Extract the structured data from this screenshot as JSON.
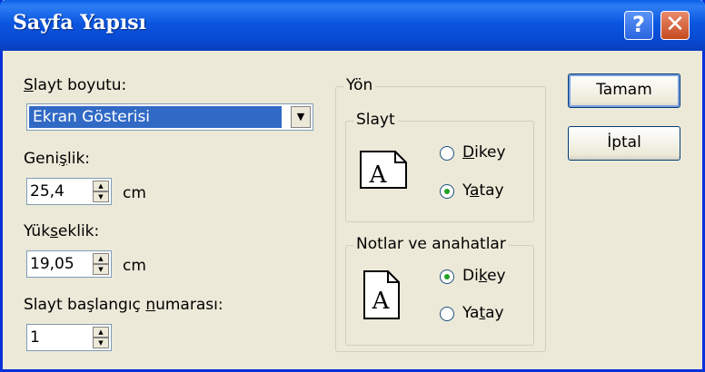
{
  "window": {
    "title": "Sayfa Yapısı",
    "help_label": "?",
    "close_label": "✕"
  },
  "slide_size": {
    "label_first": "S",
    "label_rest": "layt boyutu:",
    "value": "Ekran Gösterisi"
  },
  "width": {
    "label_pre": "Geni",
    "label_u": "ş",
    "label_post": "lik:",
    "value": "25,4",
    "unit": "cm"
  },
  "height": {
    "label_pre": "Yük",
    "label_u": "s",
    "label_post": "eklik:",
    "value": "19,05",
    "unit": "cm"
  },
  "start_number": {
    "label_pre": "Slayt başlangıç ",
    "label_u": "n",
    "label_post": "umarası:",
    "value": "1"
  },
  "orientation": {
    "title": "Yön",
    "slides": {
      "title": "Slayt",
      "portrait_u": "D",
      "portrait_rest": "ikey",
      "landscape_pre": "Y",
      "landscape_u": "a",
      "landscape_post": "tay",
      "selected": "Yatay"
    },
    "notes": {
      "title": "Notlar ve anahatlar",
      "portrait_pre": "Di",
      "portrait_u": "k",
      "portrait_post": "ey",
      "landscape_pre": "Ya",
      "landscape_u": "t",
      "landscape_post": "ay",
      "selected": "Dikey"
    }
  },
  "buttons": {
    "ok": "Tamam",
    "cancel": "İptal"
  },
  "icons": [
    "help-icon",
    "close-icon",
    "dropdown-arrow-icon",
    "spin-up-icon",
    "spin-down-icon",
    "landscape-page-icon",
    "portrait-page-icon"
  ]
}
